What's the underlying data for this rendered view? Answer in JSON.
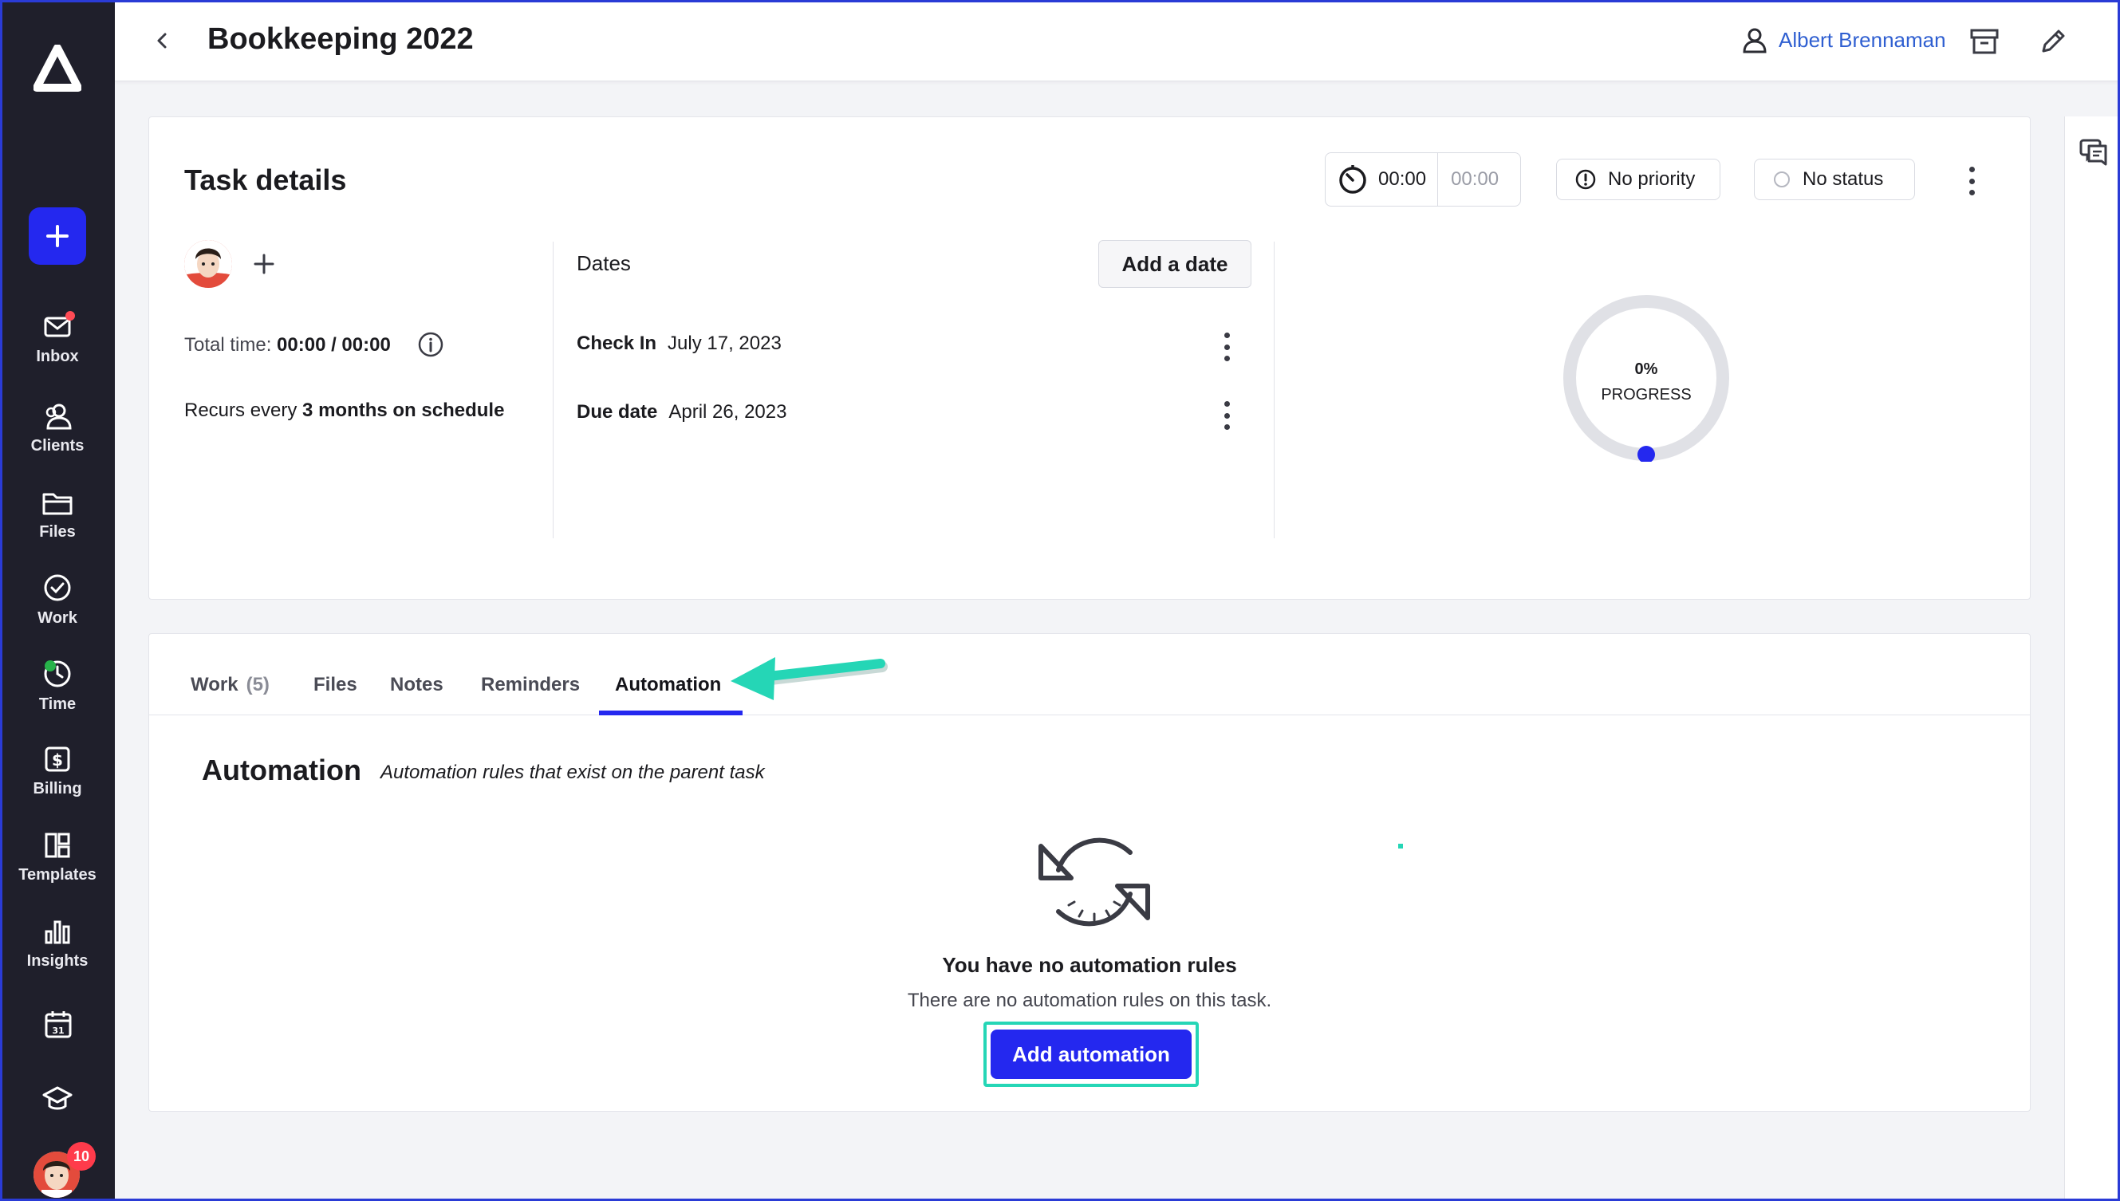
{
  "header": {
    "title": "Bookkeeping 2022",
    "owner": "Albert Brennaman"
  },
  "sidebar": {
    "items": [
      {
        "label": "Inbox",
        "icon": "mail-icon"
      },
      {
        "label": "Clients",
        "icon": "users-icon"
      },
      {
        "label": "Files",
        "icon": "folder-icon"
      },
      {
        "label": "Work",
        "icon": "check-circle-icon"
      },
      {
        "label": "Time",
        "icon": "clock-icon"
      },
      {
        "label": "Billing",
        "icon": "dollar-icon"
      },
      {
        "label": "Templates",
        "icon": "templates-icon"
      },
      {
        "label": "Insights",
        "icon": "bar-chart-icon"
      }
    ],
    "notification_count": "10"
  },
  "task": {
    "title": "Task details",
    "timer_current": "00:00",
    "timer_estimate": "00:00",
    "priority": "No priority",
    "status": "No status",
    "total_time_label": "Total time:",
    "total_time_value": "00:00 / 00:00",
    "recurs_prefix": "Recurs every",
    "recurs_value": "3 months on schedule",
    "dates_heading": "Dates",
    "add_date_label": "Add a date",
    "dates": [
      {
        "label": "Check In",
        "value": "July 17, 2023"
      },
      {
        "label": "Due date",
        "value": "April 26, 2023"
      }
    ],
    "progress_value": "0%",
    "progress_label": "PROGRESS",
    "progress_fraction": 0
  },
  "tabs": [
    {
      "label": "Work",
      "count": "(5)"
    },
    {
      "label": "Files"
    },
    {
      "label": "Notes"
    },
    {
      "label": "Reminders"
    },
    {
      "label": "Automation"
    }
  ],
  "automation": {
    "title": "Automation",
    "subtitle": "Automation rules that exist on the parent task",
    "empty_title": "You have no automation rules",
    "empty_subtitle": "There are no automation rules on this task.",
    "add_button": "Add automation"
  },
  "colors": {
    "accent": "#2428ef",
    "sidebar_bg": "#1f1f2b",
    "highlight": "#25d6b6",
    "owner_link": "#2f5fd1"
  }
}
